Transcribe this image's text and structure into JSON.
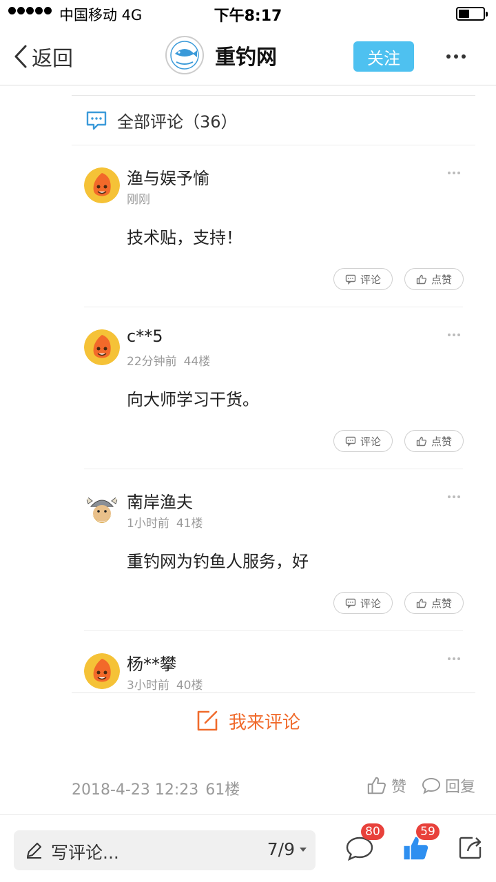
{
  "status_bar": {
    "carrier": "中国移动   4G",
    "time": "下午8:17",
    "battery_level": 0.45
  },
  "nav": {
    "back_label": "返回",
    "site_name": "重钓网",
    "follow_label": "关注"
  },
  "comments": {
    "title": "全部评论（36）",
    "reply_label": "评论",
    "like_label": "点赞",
    "items": [
      {
        "name": "渔与娱予愉",
        "time": "刚刚",
        "floor": "",
        "text": "技术贴，支持！",
        "avatar": "orange-mascot"
      },
      {
        "name": "c**5",
        "time": "22分钟前",
        "floor": "44楼",
        "text": "向大师学习干货。",
        "avatar": "orange-mascot"
      },
      {
        "name": "南岸渔夫",
        "time": "1小时前",
        "floor": "41楼",
        "text": "重钓网为钓鱼人服务，好",
        "avatar": "viking"
      },
      {
        "name": "杨**攀",
        "time": "3小时前",
        "floor": "40楼",
        "text": "",
        "avatar": "orange-mascot"
      }
    ]
  },
  "write_comment_label": "我来评论",
  "post_footer": {
    "date": "2018-4-23 12:23",
    "floor": "61楼",
    "like_label": "赞",
    "reply_label": "回复"
  },
  "bottom_bar": {
    "compose_placeholder": "写评论...",
    "page_indicator": "7/9",
    "comment_count": "80",
    "like_count": "59"
  },
  "colors": {
    "accent_blue": "#4ec1f0",
    "accent_orange": "#f06a2b",
    "badge_red": "#e8413b",
    "like_blue": "#2e8ff0"
  }
}
